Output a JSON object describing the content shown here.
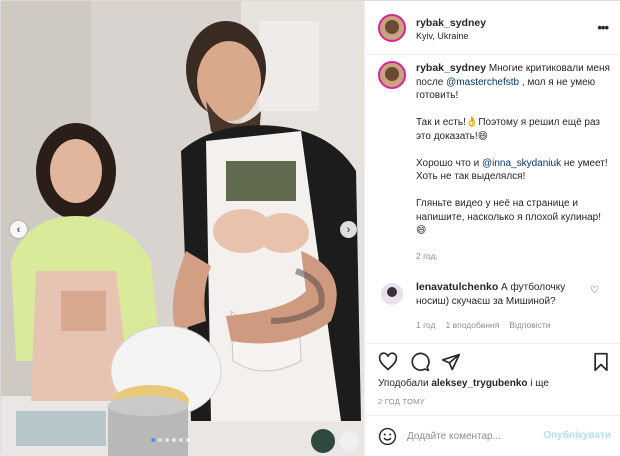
{
  "post": {
    "username": "rybak_sydney",
    "location": "Kyiv, Ukraine"
  },
  "caption": {
    "username": "rybak_sydney",
    "p1_text": " Многие критиковали меня после ",
    "p1_mention": "@masterchefstb",
    "p1_tail": " , мол я не умею готовить!",
    "p2": "Так и есть!👌Поэтому я решил ещё раз это доказать!😄",
    "p3_head": "Хорошо что и ",
    "p3_mention": "@inna_skydaniuk",
    "p3_tail": " не умеет! Хоть не так выделялся!",
    "p4": "Гляньте видео у неё на странице и напишите, насколько я плохой кулинар!😄",
    "time": "2 год."
  },
  "comment": {
    "username": "lenavatulchenko",
    "text": " А футболочку носиш) скучаєш за Мишиной?",
    "time": "1 год",
    "likes": "1 вподобання",
    "reply": "Відповісти"
  },
  "likes": {
    "prefix": "Уподобали ",
    "user": "aleksey_trygubenko",
    "suffix": " і ще"
  },
  "post_time": "2 ГОД ТОМУ",
  "add_comment": {
    "placeholder": "Додайте коментар...",
    "post_label": "Опублікувати"
  },
  "icons": {
    "more": "more-icon",
    "like": "heart-icon",
    "comment": "comment-icon",
    "share": "paper-plane-icon",
    "save": "bookmark-icon",
    "emoji": "smiley-icon",
    "prev": "chevron-left-icon",
    "next": "chevron-right-icon"
  },
  "colors": {
    "link": "#00376b",
    "muted": "#8e8e8e",
    "accent": "#3897f0",
    "post_disabled": "#b2dffc"
  }
}
